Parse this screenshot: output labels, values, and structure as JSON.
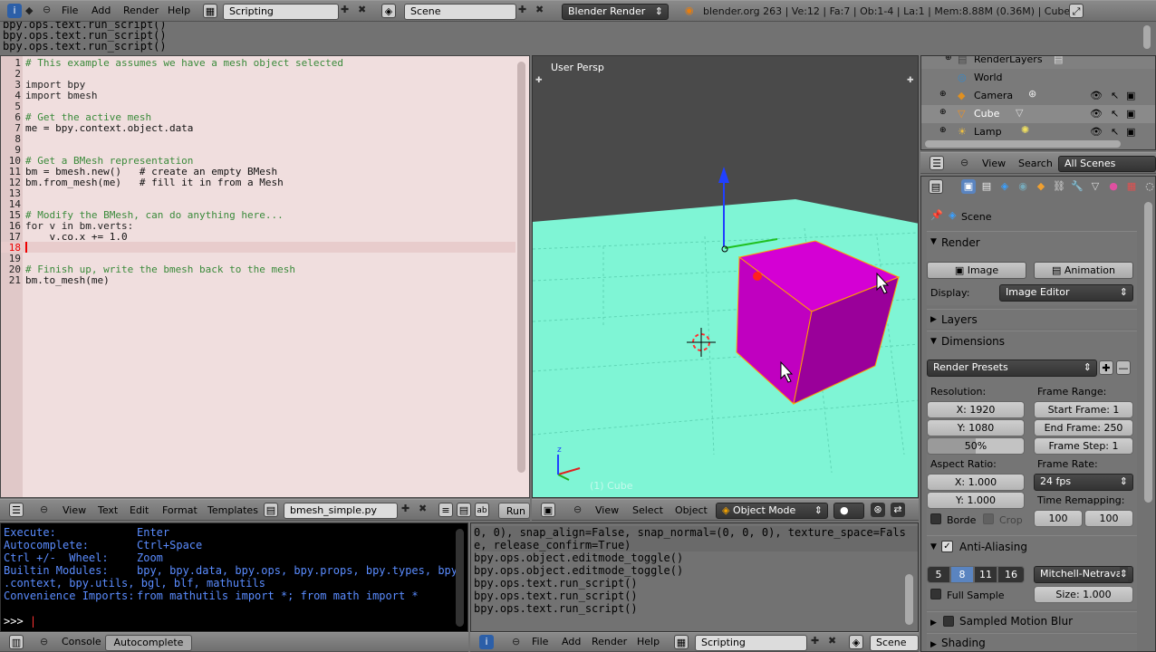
{
  "top_header": {
    "menus": [
      "File",
      "Add",
      "Render",
      "Help"
    ],
    "screen_layout": "Scripting",
    "scene": "Scene",
    "engine": "Blender Render",
    "stats": "blender.org 263 | Ve:12 | Fa:7 | Ob:1-4 | La:1 | Mem:8.88M (0.36M) | Cube"
  },
  "info_log": [
    "bpy.ops.text.run_script()",
    "bpy.ops.text.run_script()",
    "bpy.ops.text.run_script()"
  ],
  "text_editor": {
    "lines": [
      {
        "n": "1",
        "t": "# This example assumes we have a mesh object selected"
      },
      {
        "n": "2",
        "t": ""
      },
      {
        "n": "3",
        "t": "import bpy"
      },
      {
        "n": "4",
        "t": "import bmesh"
      },
      {
        "n": "5",
        "t": ""
      },
      {
        "n": "6",
        "t": "# Get the active mesh"
      },
      {
        "n": "7",
        "t": "me = bpy.context.object.data"
      },
      {
        "n": "8",
        "t": ""
      },
      {
        "n": "9",
        "t": ""
      },
      {
        "n": "10",
        "t": "# Get a BMesh representation"
      },
      {
        "n": "11",
        "t": "bm = bmesh.new()   # create an empty BMesh"
      },
      {
        "n": "12",
        "t": "bm.from_mesh(me)   # fill it in from a Mesh"
      },
      {
        "n": "13",
        "t": ""
      },
      {
        "n": "14",
        "t": ""
      },
      {
        "n": "15",
        "t": "# Modify the BMesh, can do anything here..."
      },
      {
        "n": "16",
        "t": "for v in bm.verts:"
      },
      {
        "n": "17",
        "t": "    v.co.x += 1.0"
      },
      {
        "n": "18",
        "t": ""
      },
      {
        "n": "19",
        "t": ""
      },
      {
        "n": "20",
        "t": "# Finish up, write the bmesh back to the mesh"
      },
      {
        "n": "21",
        "t": "bm.to_mesh(me)"
      }
    ],
    "menus": [
      "View",
      "Text",
      "Edit",
      "Format",
      "Templates"
    ],
    "filename": "bmesh_simple.py",
    "run_label": "Run"
  },
  "viewport": {
    "label": "User Persp",
    "object_label": "(1) Cube",
    "menus": [
      "View",
      "Select",
      "Object"
    ],
    "mode": "Object Mode",
    "colors": {
      "floor": "#7ff5d5",
      "cube": "#c800c8",
      "sky": "#4a4a4a"
    }
  },
  "console": {
    "lines": [
      {
        "a": "Execute:",
        "b": "Enter"
      },
      {
        "a": "Autocomplete:",
        "b": "Ctrl+Space"
      },
      {
        "a": "Ctrl +/-  Wheel:",
        "b": "Zoom"
      },
      {
        "a": "Builtin Modules:",
        "b": "bpy, bpy.data, bpy.ops, bpy.props, bpy.types, bpy"
      },
      {
        "a": ".context, bpy.utils, bgl, blf, mathutils",
        "b": ""
      },
      {
        "a": "Convenience Imports:",
        "b": "from mathutils import *; from math import *"
      }
    ],
    "prompt": ">>> ",
    "tabs": [
      "Console",
      "Autocomplete"
    ]
  },
  "info2": {
    "lines": [
      "0, 0), snap_align=False, snap_normal=(0, 0, 0), texture_space=Fals",
      "e, release_confirm=True)",
      "bpy.ops.object.editmode_toggle()",
      "bpy.ops.object.editmode_toggle()",
      "bpy.ops.text.run_script()",
      "bpy.ops.text.run_script()",
      "bpy.ops.text.run_script()"
    ],
    "menus": [
      "File",
      "Add",
      "Render",
      "Help"
    ],
    "layout": "Scripting",
    "scene": "Scene"
  },
  "outliner": {
    "items": [
      "RenderLayers",
      "World",
      "Camera",
      "Cube",
      "Lamp"
    ],
    "menus": [
      "View",
      "Search"
    ],
    "filter": "All Scenes"
  },
  "properties": {
    "scene": "Scene",
    "render_title": "Render",
    "image_btn": "Image",
    "animation_btn": "Animation",
    "display_label": "Display:",
    "display_value": "Image Editor",
    "layers": "Layers",
    "dimensions": "Dimensions",
    "presets": "Render Presets",
    "resolution": "Resolution:",
    "res_x": "X: 1920",
    "res_y": "Y: 1080",
    "res_pct": "50%",
    "frame_range": "Frame Range:",
    "start": "Start Frame: 1",
    "end": "End Frame: 250",
    "step": "Frame Step: 1",
    "aspect": "Aspect Ratio:",
    "asp_x": "X: 1.000",
    "asp_y": "Y: 1.000",
    "frame_rate": "Frame Rate:",
    "fps": "24 fps",
    "time_remap": "Time Remapping:",
    "remap_old": "100",
    "remap_new": "100",
    "border": "Borde",
    "crop": "Crop",
    "aa": "Anti-Aliasing",
    "aa_samples": [
      "5",
      "8",
      "11",
      "16"
    ],
    "aa_filter": "Mitchell-Netraval",
    "full_sample": "Full Sample",
    "size": "Size: 1.000",
    "smb": "Sampled Motion Blur",
    "shading": "Shading"
  }
}
